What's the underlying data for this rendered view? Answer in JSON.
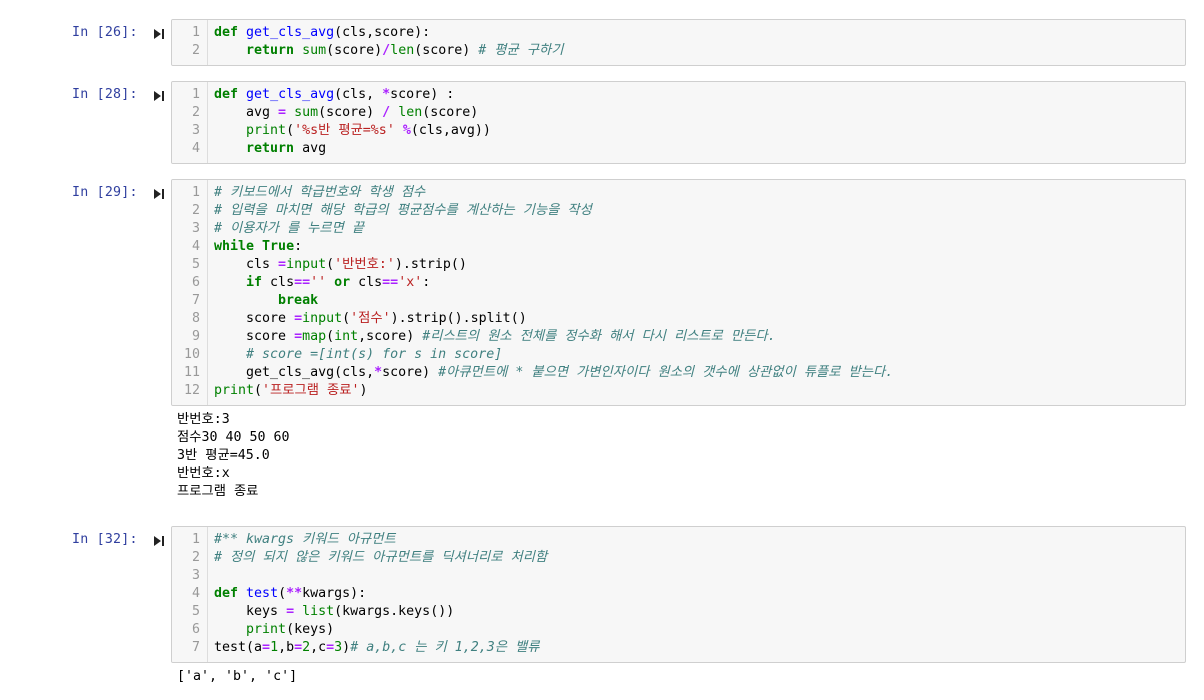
{
  "cells": [
    {
      "prompt": "In [26]:",
      "lines": [
        [
          {
            "t": "def",
            "c": "kw"
          },
          {
            "t": " "
          },
          {
            "t": "get_cls_avg",
            "c": "fn"
          },
          {
            "t": "(cls,score):"
          }
        ],
        [
          {
            "t": "    "
          },
          {
            "t": "return",
            "c": "kw"
          },
          {
            "t": " "
          },
          {
            "t": "sum",
            "c": "bi"
          },
          {
            "t": "(score)"
          },
          {
            "t": "/",
            "c": "op"
          },
          {
            "t": "len",
            "c": "bi"
          },
          {
            "t": "(score) "
          },
          {
            "t": "# 평균 구하기",
            "c": "cm"
          }
        ]
      ],
      "output": []
    },
    {
      "prompt": "In [28]:",
      "lines": [
        [
          {
            "t": "def",
            "c": "kw"
          },
          {
            "t": " "
          },
          {
            "t": "get_cls_avg",
            "c": "fn"
          },
          {
            "t": "(cls, "
          },
          {
            "t": "*",
            "c": "op"
          },
          {
            "t": "score) :"
          }
        ],
        [
          {
            "t": "    avg "
          },
          {
            "t": "=",
            "c": "op"
          },
          {
            "t": " "
          },
          {
            "t": "sum",
            "c": "bi"
          },
          {
            "t": "(score) "
          },
          {
            "t": "/",
            "c": "op"
          },
          {
            "t": " "
          },
          {
            "t": "len",
            "c": "bi"
          },
          {
            "t": "(score)"
          }
        ],
        [
          {
            "t": "    "
          },
          {
            "t": "print",
            "c": "bi"
          },
          {
            "t": "("
          },
          {
            "t": "'%s반 평균=%s'",
            "c": "st"
          },
          {
            "t": " "
          },
          {
            "t": "%",
            "c": "op"
          },
          {
            "t": "(cls,avg))"
          }
        ],
        [
          {
            "t": "    "
          },
          {
            "t": "return",
            "c": "kw"
          },
          {
            "t": " avg"
          }
        ]
      ],
      "output": []
    },
    {
      "prompt": "In [29]:",
      "lines": [
        [
          {
            "t": "# 키보드에서 학급번호와 학생 점수",
            "c": "cm"
          }
        ],
        [
          {
            "t": "# 입력을 마치면 해당 학급의 평균점수를 계산하는 기능을 작성",
            "c": "cm"
          }
        ],
        [
          {
            "t": "# 이용자가 를 누르면 끝",
            "c": "cm"
          }
        ],
        [
          {
            "t": "while",
            "c": "kw"
          },
          {
            "t": " "
          },
          {
            "t": "True",
            "c": "kw"
          },
          {
            "t": ":"
          }
        ],
        [
          {
            "t": "    cls "
          },
          {
            "t": "=",
            "c": "op"
          },
          {
            "t": "input",
            "c": "bi"
          },
          {
            "t": "("
          },
          {
            "t": "'반번호:'",
            "c": "st"
          },
          {
            "t": ").strip()"
          }
        ],
        [
          {
            "t": "    "
          },
          {
            "t": "if",
            "c": "kw"
          },
          {
            "t": " cls"
          },
          {
            "t": "==",
            "c": "op"
          },
          {
            "t": "''",
            "c": "st"
          },
          {
            "t": " "
          },
          {
            "t": "or",
            "c": "kw"
          },
          {
            "t": " cls"
          },
          {
            "t": "==",
            "c": "op"
          },
          {
            "t": "'x'",
            "c": "st"
          },
          {
            "t": ":"
          }
        ],
        [
          {
            "t": "        "
          },
          {
            "t": "break",
            "c": "kw"
          }
        ],
        [
          {
            "t": "    score "
          },
          {
            "t": "=",
            "c": "op"
          },
          {
            "t": "input",
            "c": "bi"
          },
          {
            "t": "("
          },
          {
            "t": "'점수'",
            "c": "st"
          },
          {
            "t": ").strip().split()"
          }
        ],
        [
          {
            "t": "    score "
          },
          {
            "t": "=",
            "c": "op"
          },
          {
            "t": "map",
            "c": "bi"
          },
          {
            "t": "("
          },
          {
            "t": "int",
            "c": "bi"
          },
          {
            "t": ",score) "
          },
          {
            "t": "#리스트의 원소 전체를 정수화 해서 다시 리스트로 만든다.",
            "c": "cm"
          }
        ],
        [
          {
            "t": "    "
          },
          {
            "t": "# score =[int(s) for s in score]",
            "c": "cm"
          }
        ],
        [
          {
            "t": "    get_cls_avg(cls,"
          },
          {
            "t": "*",
            "c": "op"
          },
          {
            "t": "score) "
          },
          {
            "t": "#아큐먼트에 * 붙으면 가변인자이다 원소의 갯수에 상관없이 튜플로 받는다.",
            "c": "cm"
          }
        ],
        [
          {
            "t": "print",
            "c": "bi"
          },
          {
            "t": "("
          },
          {
            "t": "'프로그램 종료'",
            "c": "st"
          },
          {
            "t": ")"
          }
        ]
      ],
      "output": [
        "반번호:3",
        "점수30 40 50 60",
        "3반 평균=45.0",
        "반번호:x",
        "프로그램 종료"
      ]
    },
    {
      "prompt": "In [32]:",
      "lines": [
        [
          {
            "t": "#** kwargs 키워드 아규먼트",
            "c": "cm"
          }
        ],
        [
          {
            "t": "# 정의 되지 않은 키워드 아규먼트를 딕셔너리로 처리함",
            "c": "cm"
          }
        ],
        [],
        [
          {
            "t": "def",
            "c": "kw"
          },
          {
            "t": " "
          },
          {
            "t": "test",
            "c": "fn"
          },
          {
            "t": "("
          },
          {
            "t": "**",
            "c": "op"
          },
          {
            "t": "kwargs):"
          }
        ],
        [
          {
            "t": "    keys "
          },
          {
            "t": "=",
            "c": "op"
          },
          {
            "t": " "
          },
          {
            "t": "list",
            "c": "bi"
          },
          {
            "t": "(kwargs.keys())"
          }
        ],
        [
          {
            "t": "    "
          },
          {
            "t": "print",
            "c": "bi"
          },
          {
            "t": "(keys)"
          }
        ],
        [
          {
            "t": "test(a"
          },
          {
            "t": "=",
            "c": "op"
          },
          {
            "t": "1",
            "c": "nm"
          },
          {
            "t": ",b"
          },
          {
            "t": "=",
            "c": "op"
          },
          {
            "t": "2",
            "c": "nm"
          },
          {
            "t": ",c"
          },
          {
            "t": "=",
            "c": "op"
          },
          {
            "t": "3",
            "c": "nm"
          },
          {
            "t": ")"
          },
          {
            "t": "# a,b,c 는 키 1,2,3은 밸류",
            "c": "cm"
          }
        ]
      ],
      "output": [
        "['a', 'b', 'c']"
      ]
    }
  ]
}
